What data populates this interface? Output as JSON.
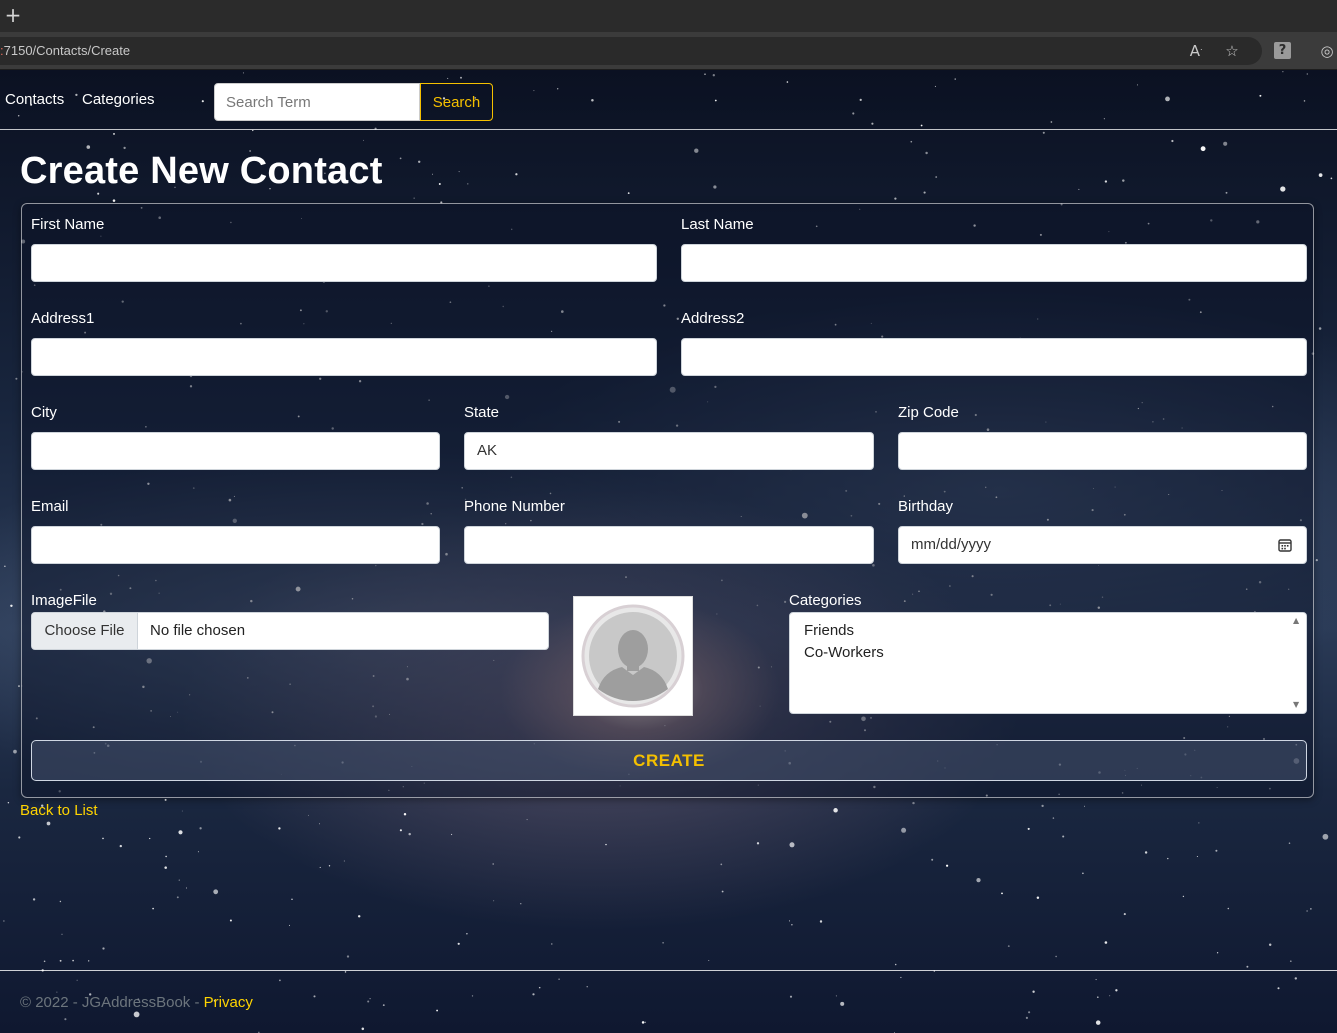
{
  "browser": {
    "url_proto": ":",
    "url_rest": "7150/Contacts/Create",
    "new_tab_icon": "plus-icon",
    "icons": [
      "read-aloud-icon",
      "add-favorite-icon",
      "help-icon",
      "copilot-icon"
    ]
  },
  "nav": {
    "contacts": "Contacts",
    "categories": "Categories",
    "search_placeholder": "Search Term",
    "search_button": "Search"
  },
  "page_title": "Create New Contact",
  "form": {
    "first_name_label": "First Name",
    "last_name_label": "Last Name",
    "address1_label": "Address1",
    "address2_label": "Address2",
    "city_label": "City",
    "state_label": "State",
    "state_value": "AK",
    "zip_label": "Zip Code",
    "email_label": "Email",
    "phone_label": "Phone Number",
    "birthday_label": "Birthday",
    "birthday_placeholder": "mm/dd/yyyy",
    "image_label": "ImageFile",
    "choose_file": "Choose File",
    "no_file": "No file chosen",
    "categories_label": "Categories",
    "categories_options": [
      "Friends",
      "Co-Workers"
    ],
    "create_button": "CREATE"
  },
  "back_link": "Back to List",
  "footer": {
    "copyright": "© 2022 - JGAddressBook -",
    "privacy": "Privacy"
  },
  "colors": {
    "accent": "#f5c000",
    "link": "#ffd400",
    "footer_text": "#6c757d"
  }
}
